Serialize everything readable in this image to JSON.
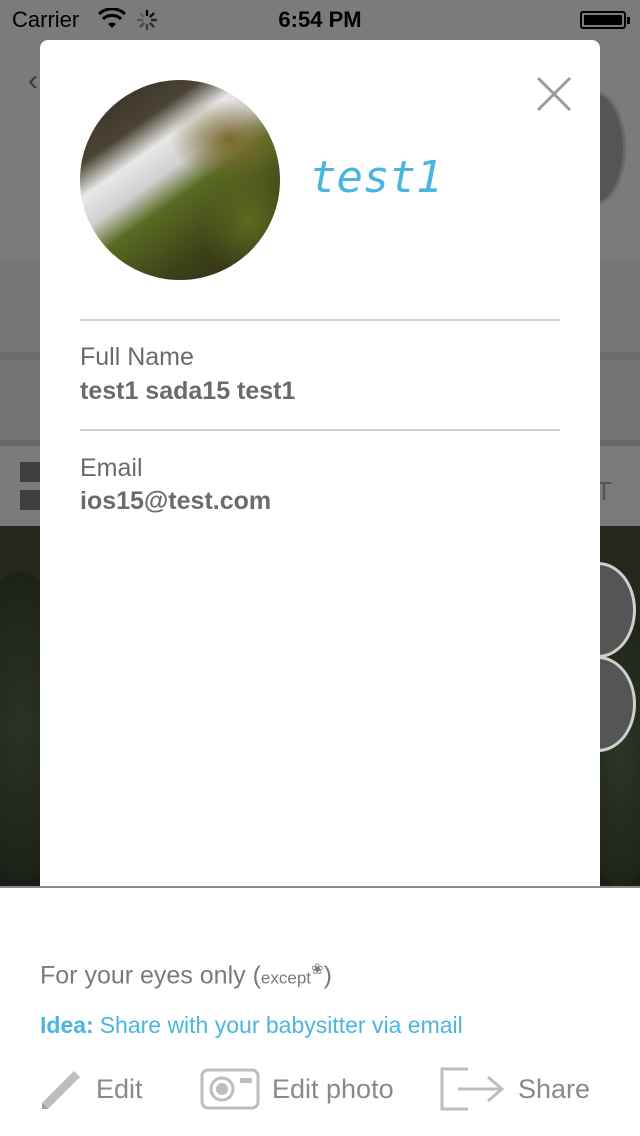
{
  "status_bar": {
    "carrier": "Carrier",
    "time": "6:54 PM"
  },
  "profile": {
    "username": "test1",
    "avatar_icon": "waterfall-photo",
    "close_icon": "close-icon",
    "full_name_label": "Full Name",
    "full_name_value": "test1 sada15 test1",
    "email_label": "Email",
    "email_value": "ios15@test.com"
  },
  "privacy": {
    "text_prefix": "For your eyes only (",
    "except_text": "except",
    "flower_glyph": "❀",
    "text_suffix": ")",
    "idea_label": "Idea:",
    "idea_text": "Share with your babysitter via email"
  },
  "actions": [
    {
      "label": "Edit",
      "icon": "pencil-icon"
    },
    {
      "label": "Edit photo",
      "icon": "camera-icon"
    },
    {
      "label": "Share",
      "icon": "share-arrow-icon"
    }
  ],
  "colors": {
    "accent": "#4ab6e0",
    "text_gray": "#6b6b6b",
    "divider": "#cfcfcf"
  }
}
